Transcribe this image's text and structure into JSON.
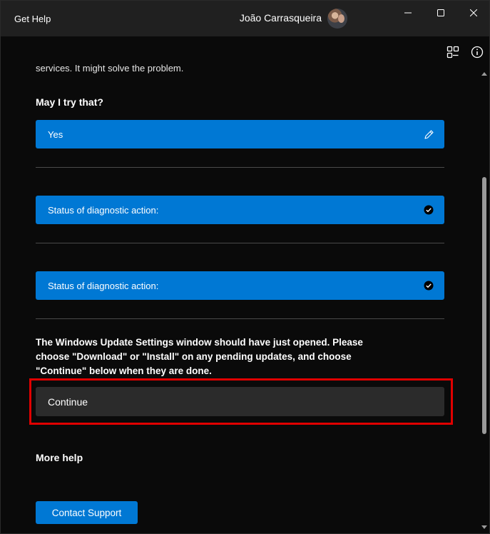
{
  "window": {
    "app_title": "Get Help",
    "user_name": "João Carrasqueira"
  },
  "conversation": {
    "cutoff_text": "services. It might solve the problem.",
    "question": "May I try that?",
    "answer": "Yes",
    "status_items": [
      "Status of diagnostic action:",
      "Status of diagnostic action:"
    ],
    "instructions": "The Windows Update Settings window should have just opened. Please choose \"Download\" or \"Install\" on any pending updates, and choose \"Continue\" below when they are done.",
    "continue_label": "Continue"
  },
  "more_help": {
    "heading": "More help",
    "contact_label": "Contact Support"
  },
  "icons": {
    "edit": "pencil-icon",
    "status": "check-circle-icon",
    "share": "share-screen-icon",
    "info": "info-icon"
  },
  "colors": {
    "accent": "#0078d4",
    "highlight": "#e00000",
    "background": "#0a0a0a",
    "titlebar": "#202020"
  }
}
